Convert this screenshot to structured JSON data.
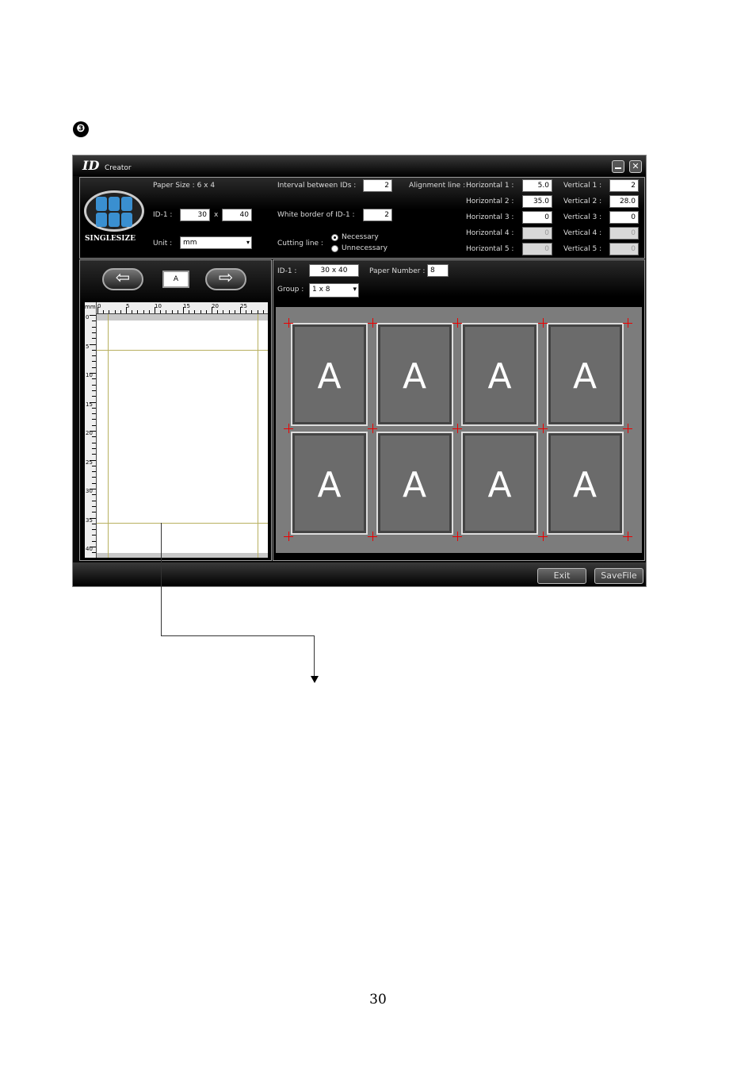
{
  "step_marker": "❸",
  "page_number": "30",
  "app": {
    "logo": "ID",
    "title": "Creator"
  },
  "settings": {
    "paper_size": "Paper Size : 6 x 4",
    "badge": "SINGLESIZE",
    "id_label": "ID-1 :",
    "id_w": "30",
    "id_x": "x",
    "id_h": "40",
    "unit_label": "Unit :",
    "unit_value": "mm",
    "interval_label": "Interval between IDs :",
    "interval_value": "2",
    "white_border_label": "White border of ID-1 :",
    "white_border_value": "2",
    "cutting_label": "Cutting line :",
    "cutting_opt1": "Necessary",
    "cutting_opt2": "Unnecessary",
    "align_label": "Alignment line :",
    "horizontal": [
      {
        "label": "Horizontal 1 :",
        "value": "5.0"
      },
      {
        "label": "Horizontal 2 :",
        "value": "35.0"
      },
      {
        "label": "Horizontal 3 :",
        "value": "0"
      },
      {
        "label": "Horizontal 4 :",
        "value": "0"
      },
      {
        "label": "Horizontal 5 :",
        "value": "0"
      }
    ],
    "vertical": [
      {
        "label": "Vertical 1 :",
        "value": "2"
      },
      {
        "label": "Vertical 2 :",
        "value": "28.0"
      },
      {
        "label": "Vertical 3 :",
        "value": "0"
      },
      {
        "label": "Vertical 4 :",
        "value": "0"
      },
      {
        "label": "Vertical 5 :",
        "value": "0"
      }
    ]
  },
  "left": {
    "selected": "A",
    "ruler_unit": "mm",
    "ruler_h": [
      "0",
      "5",
      "10",
      "15",
      "20",
      "25"
    ],
    "ruler_v": [
      "0",
      "5",
      "10",
      "15",
      "20",
      "25",
      "30",
      "35",
      "40"
    ]
  },
  "right": {
    "id_label": "ID-1 :",
    "id_value": "30 x 40",
    "paper_label": "Paper Number :",
    "paper_value": "8",
    "group_label": "Group :",
    "group_value": "1 x 8",
    "cards": [
      "A",
      "A",
      "A",
      "A",
      "A",
      "A",
      "A",
      "A"
    ]
  },
  "footer": {
    "exit": "Exit",
    "save": "SaveFile"
  }
}
